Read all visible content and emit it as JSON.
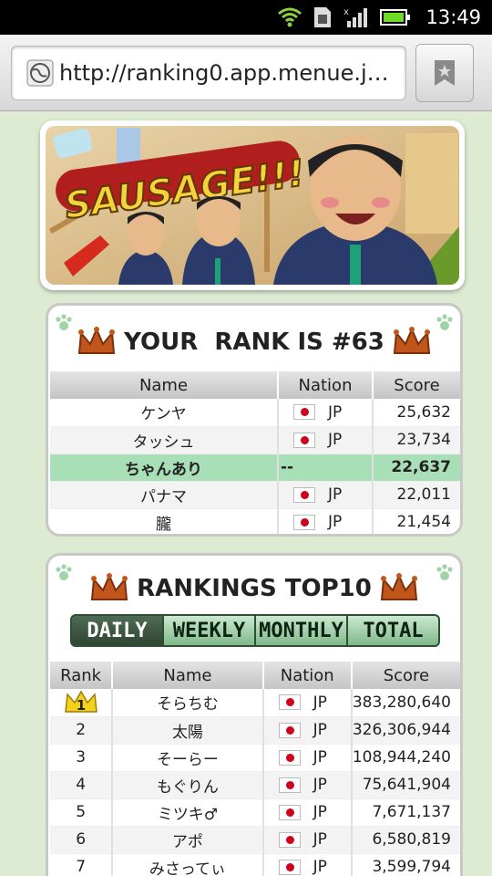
{
  "status_bar": {
    "time": "13:49"
  },
  "browser": {
    "url": "http://ranking0.app.menue.j…"
  },
  "banner": {
    "logo_text": "SAUSAGE!!!"
  },
  "your_rank": {
    "title": "YOUR  RANK IS #63",
    "columns": [
      "Name",
      "Nation",
      "Score"
    ],
    "rows": [
      {
        "name": "ケンヤ",
        "nation": "JP",
        "score": "25,632"
      },
      {
        "name": "タッシュ",
        "nation": "JP",
        "score": "23,734"
      },
      {
        "name": "ちゃんあり",
        "nation": "--",
        "score": "22,637"
      },
      {
        "name": "パナマ",
        "nation": "JP",
        "score": "22,011"
      },
      {
        "name": "朧",
        "nation": "JP",
        "score": "21,454"
      }
    ]
  },
  "top10": {
    "title": "RANKINGS TOP10",
    "tabs": [
      "DAILY",
      "WEEKLY",
      "MONTHLY",
      "TOTAL"
    ],
    "active_tab": "DAILY",
    "columns": [
      "Rank",
      "Name",
      "Nation",
      "Score"
    ],
    "rows": [
      {
        "rank": "1",
        "name": "そらちむ",
        "nation": "JP",
        "score": "383,280,640"
      },
      {
        "rank": "2",
        "name": "太陽",
        "nation": "JP",
        "score": "326,306,944"
      },
      {
        "rank": "3",
        "name": "そーらー",
        "nation": "JP",
        "score": "108,944,240"
      },
      {
        "rank": "4",
        "name": "もぐりん",
        "nation": "JP",
        "score": "75,641,904"
      },
      {
        "rank": "5",
        "name": "ミツキ♂",
        "nation": "JP",
        "score": "7,671,137"
      },
      {
        "rank": "6",
        "name": "アポ",
        "nation": "JP",
        "score": "6,580,819"
      },
      {
        "rank": "7",
        "name": "みさってぃ",
        "nation": "JP",
        "score": "3,599,794"
      }
    ]
  },
  "colors": {
    "highlight_row": "#a9dfb6",
    "page_bg": "#dcebd2",
    "tab_active": "#2e4633",
    "flag_red": "#d0021b"
  }
}
